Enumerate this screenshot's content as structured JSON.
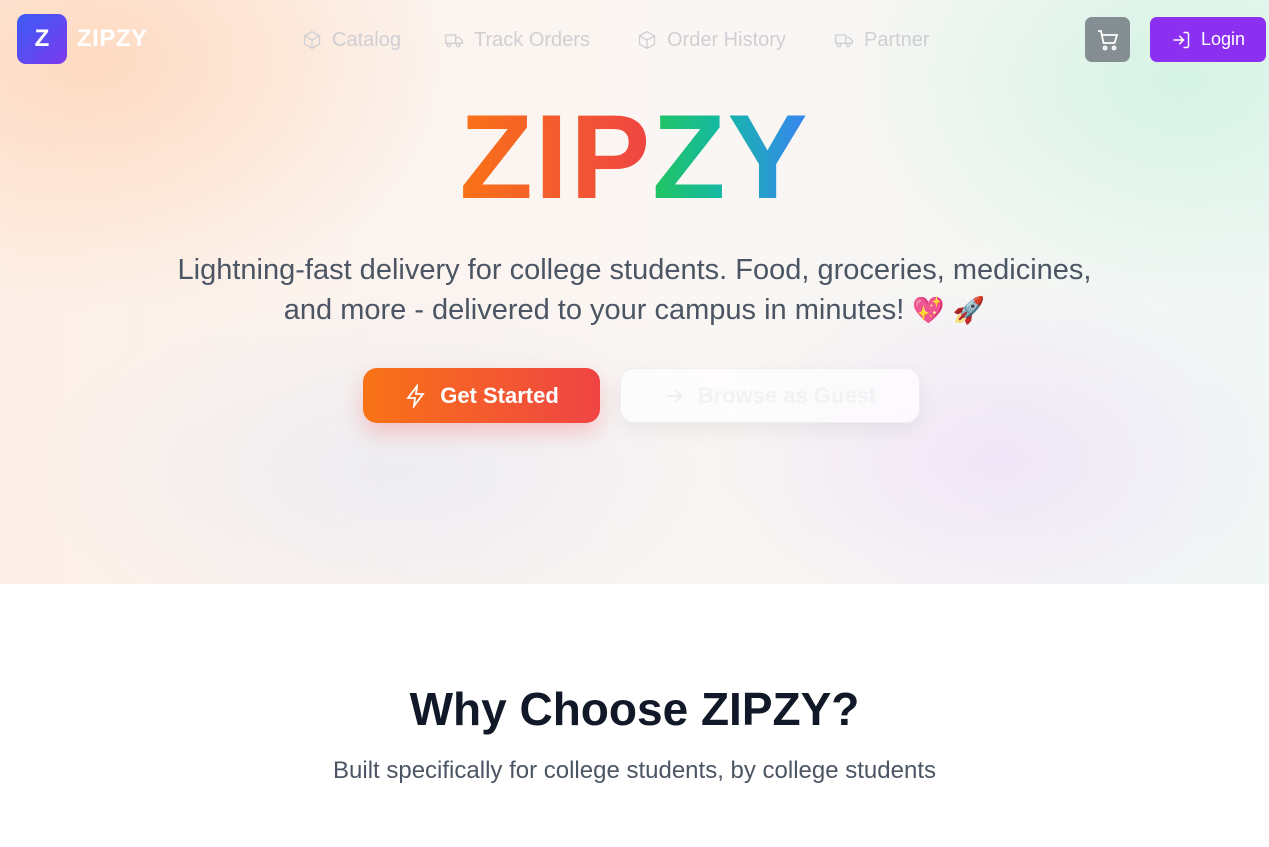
{
  "brand": {
    "logo_letter": "Z",
    "name": "ZIPZY"
  },
  "nav": {
    "items": [
      {
        "label": "Catalog",
        "icon": "box-icon"
      },
      {
        "label": "Track Orders",
        "icon": "truck-icon"
      },
      {
        "label": "Order History",
        "icon": "box-icon"
      },
      {
        "label": "Partner",
        "icon": "truck-icon"
      }
    ],
    "cart_icon": "cart-icon",
    "login_label": "Login"
  },
  "hero": {
    "title_part1": "ZIP",
    "title_part2": "ZY",
    "tagline": "Lightning-fast delivery for college students. Food, groceries, medicines, and more - delivered to your campus in minutes!",
    "emoji_heart": "💖",
    "emoji_rocket": "🚀",
    "primary_button": "Get Started",
    "secondary_button": "Browse as Guest"
  },
  "features": {
    "title": "Why Choose ZIPZY?",
    "subtitle": "Built specifically for college students, by college students"
  },
  "colors": {
    "brand_gradient_start": "#3b5cf6",
    "brand_gradient_end": "#7c3aed",
    "login_bg": "#8b2ff0",
    "cart_bg": "#858e93",
    "primary_gradient_start": "#f97316",
    "primary_gradient_end": "#ef4444",
    "title_green": "#22c55e",
    "title_blue": "#3b82f6"
  }
}
